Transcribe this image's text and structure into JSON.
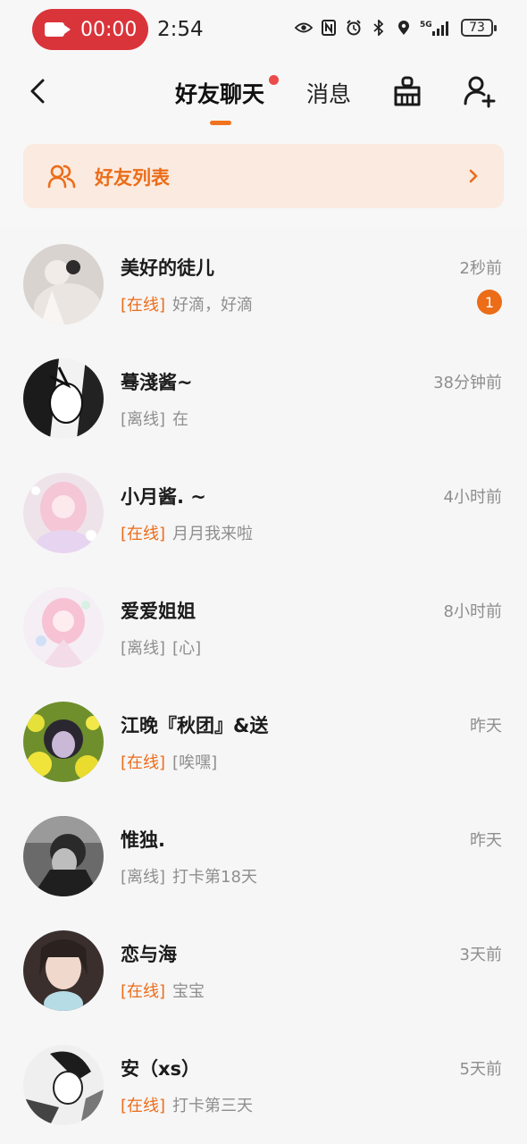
{
  "status_bar": {
    "recording_time": "00:00",
    "clock": "2:54",
    "network": "5G",
    "battery": "73"
  },
  "header": {
    "tabs": [
      {
        "label": "好友聊天",
        "active": true,
        "has_dot": true
      },
      {
        "label": "消息",
        "active": false
      }
    ]
  },
  "friend_list_banner": {
    "label": "好友列表"
  },
  "colors": {
    "accent": "#ec6c18",
    "badge": "#ec6c18",
    "tab_dot": "#ec4b4b",
    "banner_bg": "#fbeadf",
    "rec_pill": "#d9343a"
  },
  "chats": [
    {
      "name": "美好的徒儿",
      "time": "2秒前",
      "status": "[在线]",
      "online": true,
      "message": "好滴，好滴",
      "unread": "1"
    },
    {
      "name": "蓦淺酱~",
      "time": "38分钟前",
      "status": "[离线]",
      "online": false,
      "message": "在"
    },
    {
      "name": "小月酱. ~",
      "time": "4小时前",
      "status": "[在线]",
      "online": true,
      "message": "月月我来啦"
    },
    {
      "name": "爱爱姐姐",
      "time": "8小时前",
      "status": "[离线]",
      "online": false,
      "message": "[心]"
    },
    {
      "name": "江晚『秋团』&送",
      "time": "昨天",
      "status": "[在线]",
      "online": true,
      "message": "[唉嘿]"
    },
    {
      "name": "惟独.",
      "time": "昨天",
      "status": "[离线]",
      "online": false,
      "message": "打卡第18天"
    },
    {
      "name": "恋与海",
      "time": "3天前",
      "status": "[在线]",
      "online": true,
      "message": "宝宝"
    },
    {
      "name": "安（xs）",
      "time": "5天前",
      "status": "[在线]",
      "online": true,
      "message": "打卡第三天"
    }
  ]
}
